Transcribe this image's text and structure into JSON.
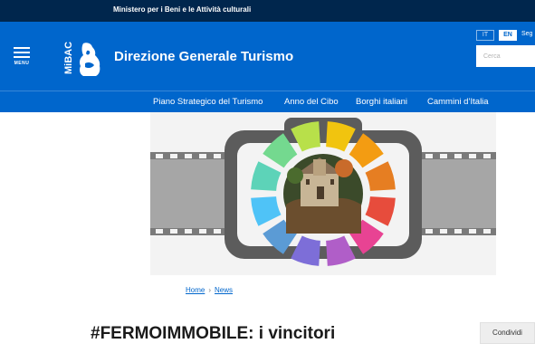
{
  "topbar": {
    "ministry": "Ministero per i Beni e le Attività culturali"
  },
  "header": {
    "menu_label": "MENU",
    "logo_text": "MiBAC",
    "site_title": "Direzione Generale Turismo",
    "languages": [
      "IT",
      "EN"
    ],
    "active_language": "EN",
    "truncated_link": "Seg",
    "search_placeholder": "Cerca"
  },
  "nav": {
    "items": [
      {
        "label": "Piano Strategico del Turismo"
      },
      {
        "label": "Anno del Cibo"
      },
      {
        "label": "Borghi italiani"
      },
      {
        "label": "Cammini d’Italia"
      }
    ]
  },
  "breadcrumb": {
    "home": "Home",
    "separator": "›",
    "current": "News"
  },
  "article": {
    "title": "#FERMOIMMOBILE: i vincitori"
  },
  "actions": {
    "share_label": "Condividi"
  },
  "colors": {
    "topbar": "#00264d",
    "header": "#0066cc",
    "camera": "#5c5c5c",
    "wheel": [
      "#f1c40f",
      "#f39c12",
      "#e67e22",
      "#e74c3c",
      "#e84393",
      "#b05ec8",
      "#7d6ed8",
      "#5b9bd5",
      "#4fc3f7",
      "#5dd3b8",
      "#74d98f",
      "#b8e04a"
    ]
  },
  "icons": {
    "menu": "hamburger-icon",
    "logo": "mibac-logo"
  }
}
